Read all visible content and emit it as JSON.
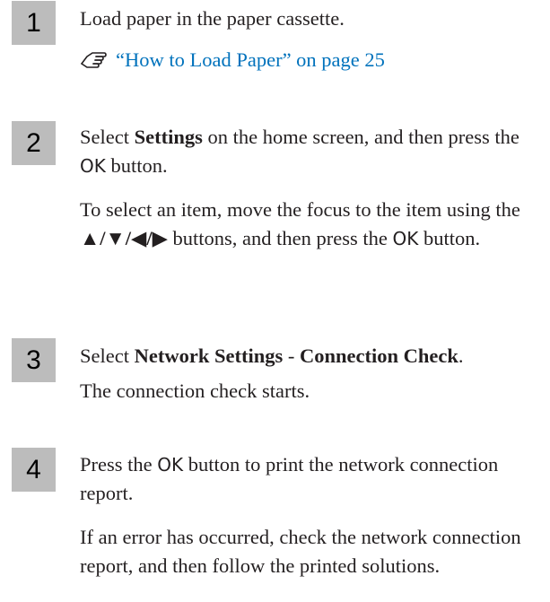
{
  "steps": [
    {
      "number": "1",
      "text": "Load paper in the paper cassette.",
      "ref_link": "“How to Load Paper” on page 25"
    },
    {
      "number": "2",
      "pre": "Select ",
      "bold1": "Settings",
      "mid": " on the home screen, and then press the ",
      "ok": "OK",
      "post": " button.",
      "note_pre": "To select an item, move the focus to the item using the ",
      "arrows": "▲/▼/◀/▶",
      "note_mid": " buttons, and then press the ",
      "note_ok": "OK",
      "note_post": " button."
    },
    {
      "number": "3",
      "pre": "Select ",
      "bold1": "Network Settings",
      "mid": " - ",
      "bold2": "Connection Check",
      "post": ".",
      "note": "The connection check starts."
    },
    {
      "number": "4",
      "pre": "Press the ",
      "ok": "OK",
      "post": " button to print the network connection report.",
      "note": "If an error has occurred, check the network connection report, and then follow the printed solutions."
    }
  ],
  "colors": {
    "box": "#bcbcbc",
    "link": "#0072bc",
    "text": "#231f20"
  },
  "icons": {
    "reference": "pointing-hand-reference-icon"
  }
}
